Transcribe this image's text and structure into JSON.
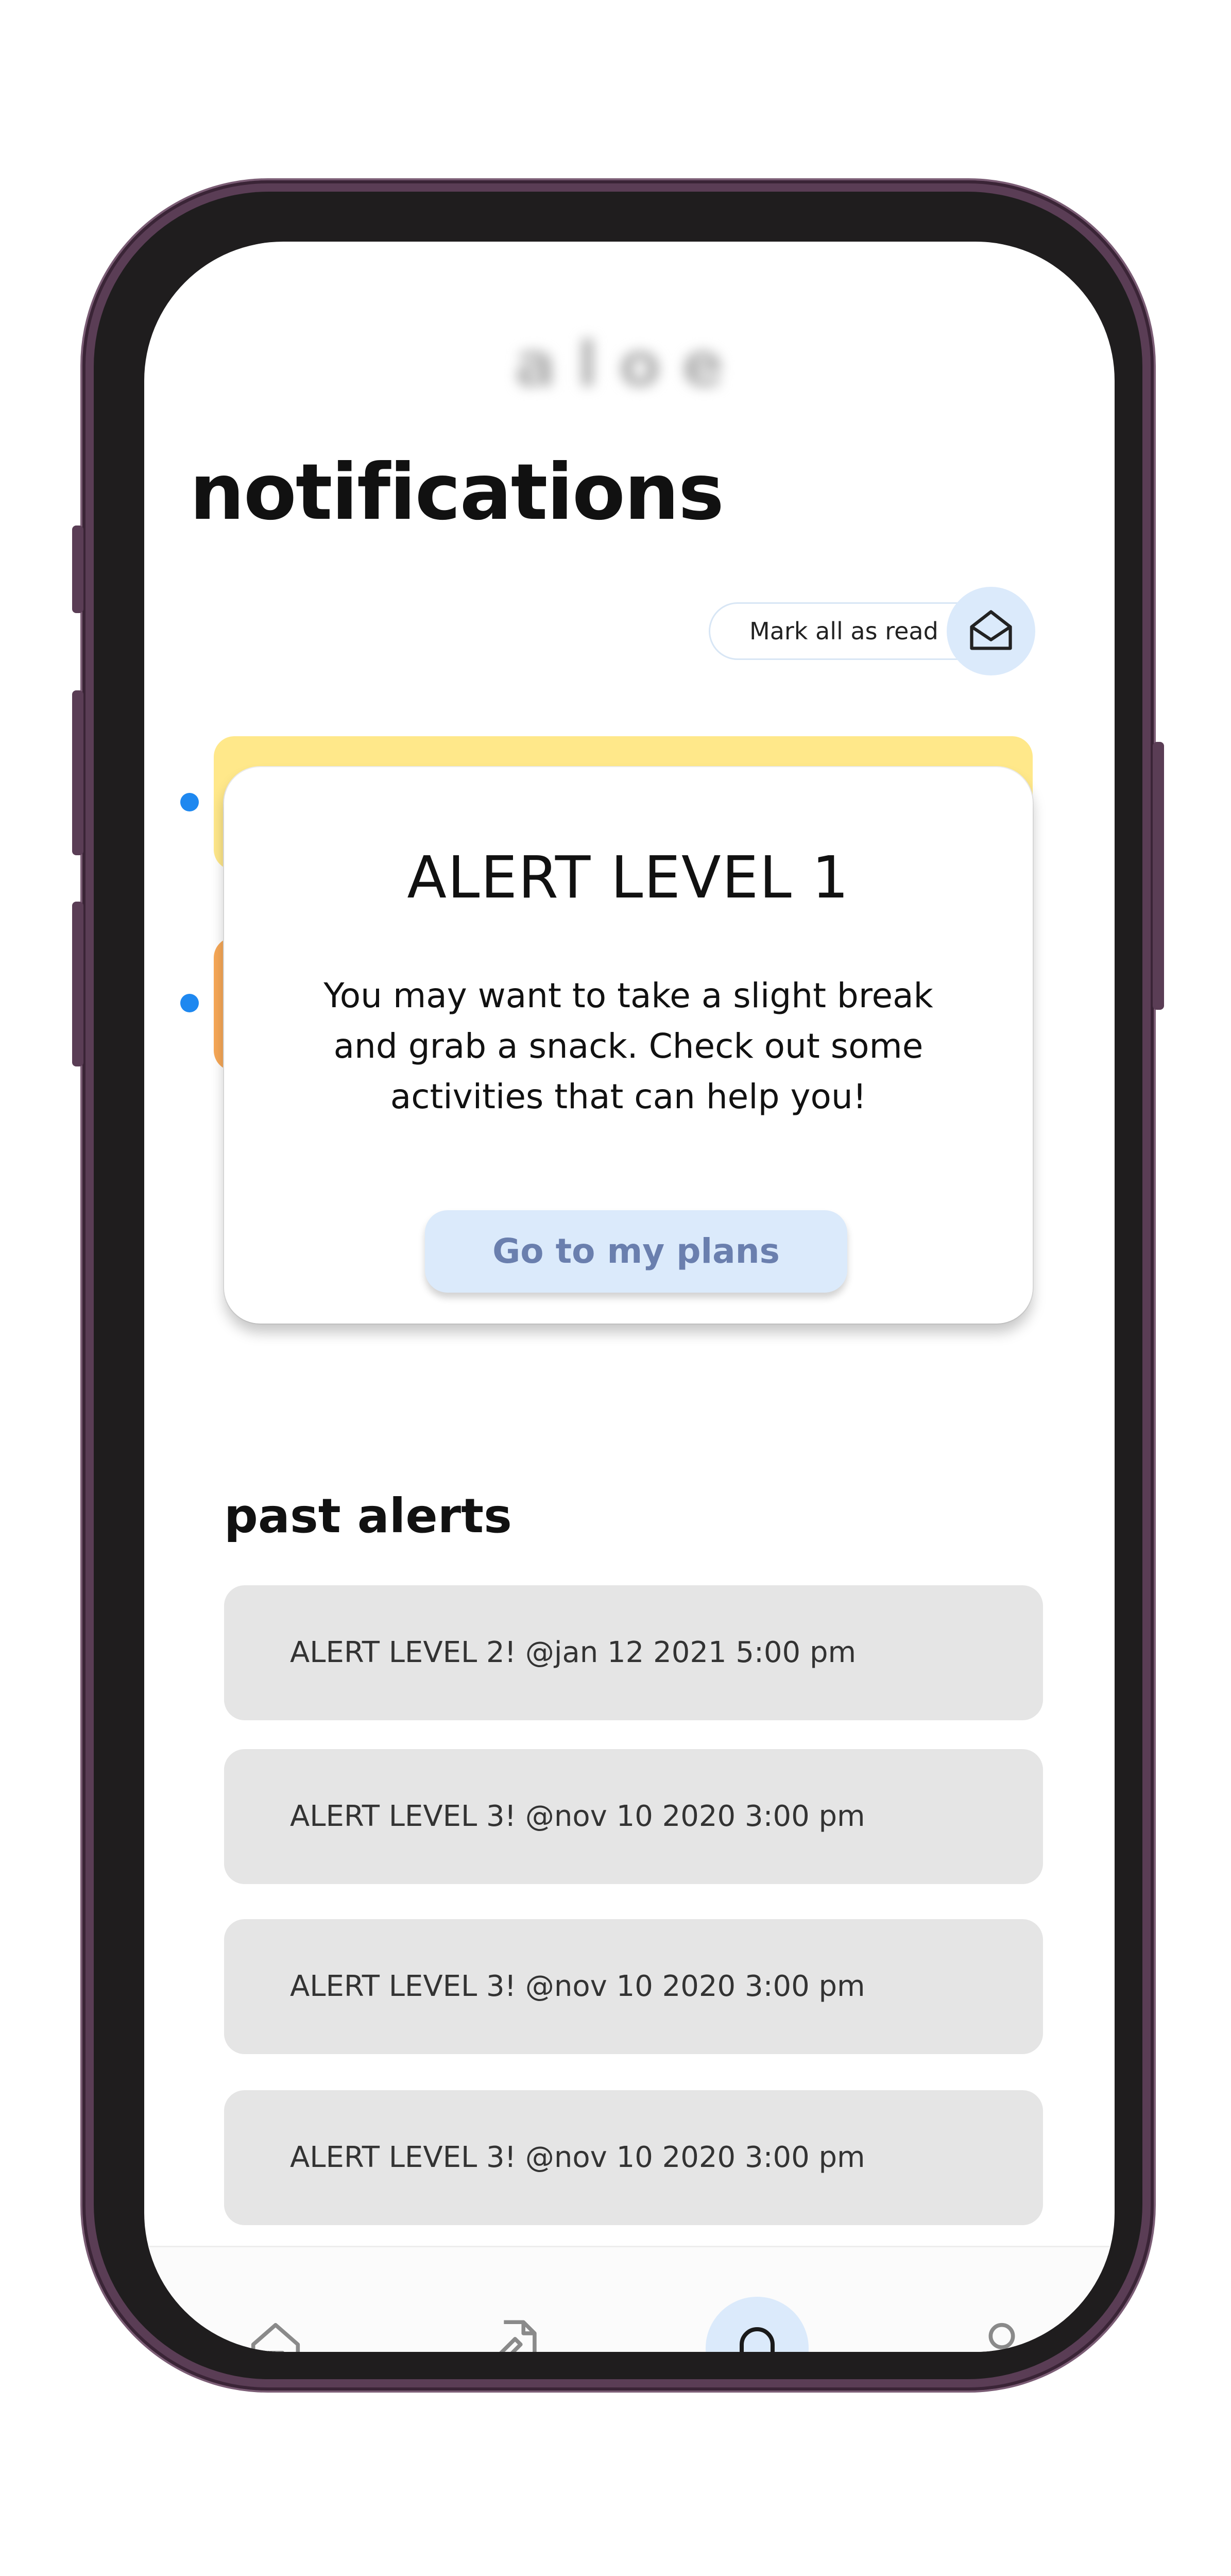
{
  "app": {
    "logo": "aloe"
  },
  "page": {
    "title": "notifications"
  },
  "actions": {
    "mark_all_label": "Mark all as read"
  },
  "alert": {
    "title": "ALERT LEVEL 1",
    "body": "You may want to take a slight break and grab a snack. Check out some activities that can help you!",
    "button_label": "Go to my plans"
  },
  "past_alerts": {
    "title": "past alerts",
    "items": [
      {
        "label": "ALERT LEVEL 2! @jan 12 2021 5:00 pm"
      },
      {
        "label": "ALERT LEVEL 3! @nov 10 2020 3:00 pm"
      },
      {
        "label": "ALERT LEVEL 3! @nov 10 2020 3:00 pm"
      },
      {
        "label": "ALERT LEVEL 3! @nov 10 2020 3:00 pm"
      }
    ]
  },
  "nav": {
    "items": [
      {
        "icon": "home-icon"
      },
      {
        "icon": "edit-document-icon"
      },
      {
        "icon": "bell-icon",
        "active": true
      },
      {
        "icon": "user-icon"
      }
    ]
  },
  "colors": {
    "accent_light": "#dbeafb",
    "notification_yellow": "#ffe88a",
    "notification_orange": "#f7a857",
    "unread_dot": "#1e88f0",
    "phone_frame": "#5a3d55"
  }
}
